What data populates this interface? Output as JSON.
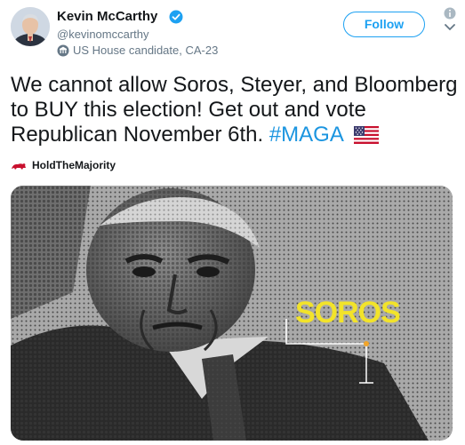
{
  "author": {
    "name": "Kevin McCarthy",
    "handle": "@kevinomccarthy",
    "label": "US House candidate, CA-23",
    "verified": true
  },
  "actions": {
    "follow_label": "Follow"
  },
  "tweet": {
    "text_main": "We cannot allow Soros, Steyer, and Bloomberg to BUY this election! Get out and vote Republican November 6th.",
    "hashtag": "#MAGA"
  },
  "promo": {
    "label": "HoldTheMajority"
  },
  "media": {
    "overlay_word": "SOROS"
  },
  "colors": {
    "accent": "#1da1f2",
    "hashtag": "#1b95e0",
    "overlay_yellow": "#f2e32a"
  },
  "icons": [
    "verified-badge-icon",
    "candidate-label-icon",
    "info-icon",
    "chevron-down-icon",
    "us-flag-emoji-icon",
    "hold-the-majority-logo-icon"
  ]
}
